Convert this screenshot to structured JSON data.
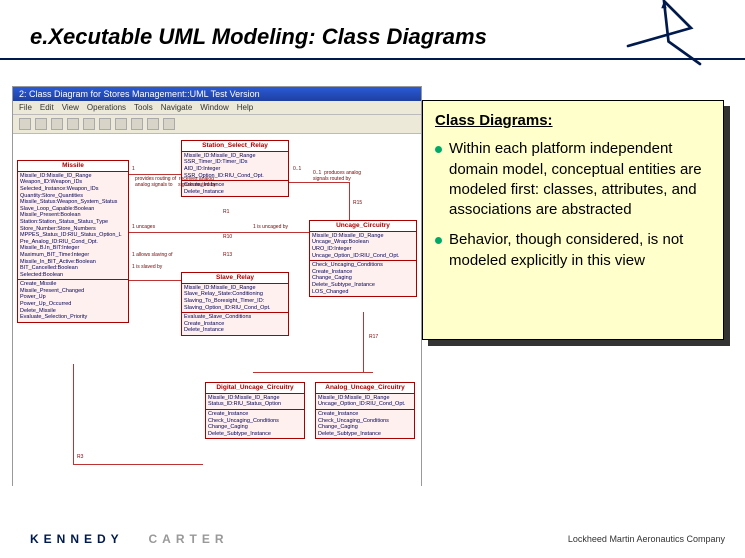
{
  "title": "e.Xecutable UML Modeling: Class Diagrams",
  "screenshot": {
    "window_title": "2: Class Diagram for Stores Management::UML Test Version",
    "menu": [
      "File",
      "Edit",
      "View",
      "Operations",
      "Tools",
      "Navigate",
      "Window",
      "Help"
    ],
    "classes": {
      "missile": {
        "name": "Missile",
        "section_label": "attributes",
        "attrs": "Missile_ID:Missile_ID_Range\nWeapon_ID:Weapon_IDs\nSelected_Instance:Weapon_IDs\nQuantity:Store_Quantities\nMissile_Status:Weapon_System_Status\nSlave_Loop_Capable:Boolean\nMissile_Present:Boolean\nStation:Station_Status_Status_Type\nStore_Number:Store_Numbers\nMPPES_Status_ID:RIU_Status_Option_L\nPre_Analog_ID:RIU_Cond_Opt.\nMissile_B.In_BIT:Integer\nMaximum_BIT_Time:Integer\nMissile_In_BIT_Active:Boolean\nBIT_Cancelled:Boolean\nSelected:Boolean",
        "ops_label": "operations",
        "ops": "Create_Missile\nMissile_Present_Changed\nPower_Up\nPower_Up_Occurred\nDelete_Missile\nEvaluate_Selection_Priority"
      },
      "ssr": {
        "name": "Station_Select_Relay",
        "section_label": "attributes",
        "attrs": "Missile_ID:Missile_ID_Range\nSSR_Timer_ID:Timer_IDs\nAID_ID:Integer\nSSR_Option_ID:RIU_Cond_Opt.",
        "ops_label": "operations",
        "ops": "Create_Instance\nDelete_Instance"
      },
      "slave": {
        "name": "Slave_Relay",
        "section_label": "attributes",
        "attrs": "Missile_ID:Missile_ID_Range\nSlave_Relay_State:Conditioning\nSlaving_To_Boresight_Timer_ID:\nSlaving_Option_ID:RIU_Cond_Opt.",
        "ops_label": "operations",
        "ops": "Evaluate_Slave_Conditions\nCreate_Instance\nDelete_Instance"
      },
      "uncage": {
        "name": "Uncage_Circuitry",
        "section_label": "attributes",
        "attrs": "Missile_ID:Missile_ID_Range\nUncage_Wrap:Boolean\nURO_ID:Integer\nUncage_Option_ID:RIU_Cond_Opt.",
        "ops_label": "operations",
        "ops": "Check_Uncaging_Conditions\nCreate_Instance\nChange_Caging\nDelete_Subtype_Instance\nLOS_Changed"
      },
      "digital": {
        "name": "Digital_Uncage_Circuitry",
        "section_label": "attributes",
        "attrs": "Missile_ID:Missile_ID_Range\nStatus_ID:RIU_Status_Option",
        "ops_label": "operations",
        "ops": "Create_Instance\nCheck_Uncaging_Conditions\nChange_Caging\nDelete_Subtype_Instance"
      },
      "analog": {
        "name": "Analog_Uncage_Circuitry",
        "section_label": "attributes",
        "attrs": "Missile_ID:Missile_ID_Range\nUncage_Option_ID:RIU_Cond_Opt.",
        "ops_label": "operations",
        "ops": "Create_Instance\nCheck_Uncaging_Conditions\nChange_Caging\nDelete_Subtype_Instance"
      }
    },
    "rel_labels": {
      "r1_left": "1",
      "r1_mid": "provides routing of  receives analog\nanalog signals to    signals routed by",
      "r1_right": "0..1",
      "r1_tag": "R1",
      "r3": "R3",
      "r10_left": "1  uncages",
      "r10_mid": "R10",
      "r10_right": "1  is uncaged by",
      "r13_left": "1  allows slaving of",
      "r13_mid": "R13",
      "r13_right": "1  is slaved by",
      "r15_top": "0..1  produces analog\nsignals routed by",
      "r15_mid": "R15",
      "r17": "R17"
    }
  },
  "callout": {
    "title": "Class Diagrams:",
    "bullets": [
      "Within each platform independent domain model, conceptual entities are modeled first: classes, attributes, and associations are abstracted",
      "Behavior, though considered, is not modeled explicitly in this view"
    ]
  },
  "footer": {
    "left_a": "KENNEDY",
    "left_b": "CARTER",
    "right": "Lockheed Martin Aeronautics Company"
  }
}
